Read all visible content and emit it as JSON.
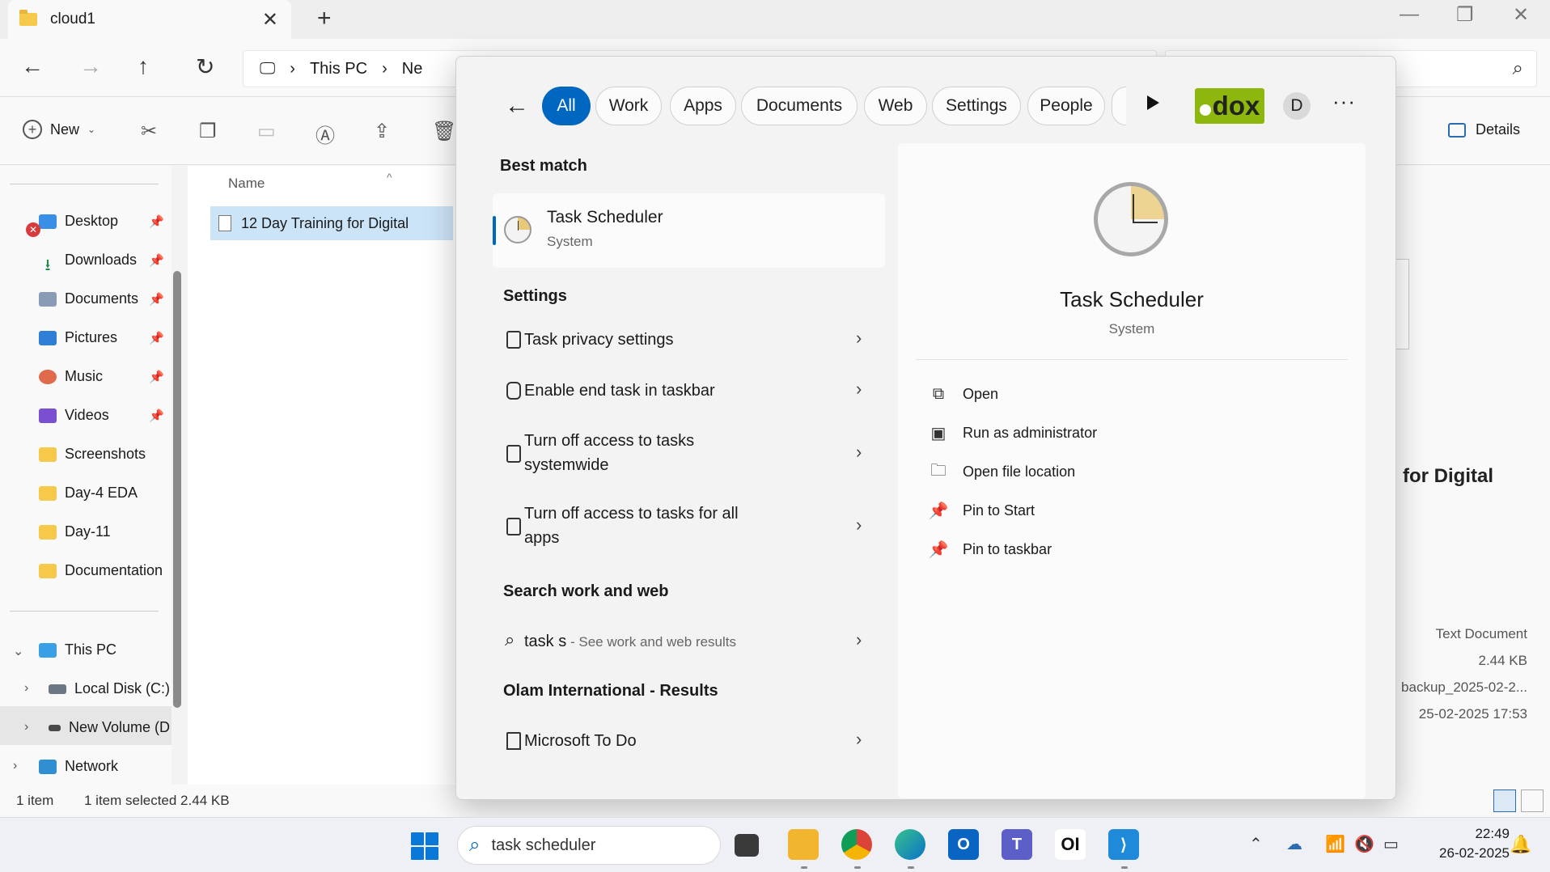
{
  "window": {
    "tab_title": "cloud1",
    "new_tab": "+",
    "minimize": "—",
    "restore": "❐",
    "close": "✕"
  },
  "nav": {
    "back": "←",
    "forward": "→",
    "up": "↑",
    "refresh": "↻",
    "breadcrumb": [
      "This PC",
      "Ne"
    ]
  },
  "commandbar": {
    "new_label": "New",
    "details_label": "Details"
  },
  "sidebar": {
    "quick_access": [
      {
        "label": "Desktop",
        "pinned": true
      },
      {
        "label": "Downloads",
        "pinned": true
      },
      {
        "label": "Documents",
        "pinned": true
      },
      {
        "label": "Pictures",
        "pinned": true
      },
      {
        "label": "Music",
        "pinned": true
      },
      {
        "label": "Videos",
        "pinned": true
      },
      {
        "label": "Screenshots",
        "pinned": false
      },
      {
        "label": "Day-4 EDA",
        "pinned": false
      },
      {
        "label": "Day-11",
        "pinned": false
      },
      {
        "label": "Documentation",
        "pinned": false
      }
    ],
    "this_pc": "This PC",
    "drives": [
      "Local Disk (C:)",
      "New Volume (D"
    ],
    "network": "Network"
  },
  "files": {
    "column_name": "Name",
    "rows": [
      "12 Day Training for Digital"
    ]
  },
  "preview": {
    "title": "g for Digital",
    "type": "Text Document",
    "size": "2.44 KB",
    "path": "backup_2025-02-2...",
    "modified": "25-02-2025 17:53"
  },
  "statusbar": {
    "count": "1 item",
    "selected": "1 item selected  2.44 KB"
  },
  "search": {
    "filters": [
      "All",
      "Work",
      "Apps",
      "Documents",
      "Web",
      "Settings",
      "People"
    ],
    "active_filter": "All",
    "org_logo": "dox",
    "avatar_letter": "D",
    "more": "···",
    "best_match_heading": "Best match",
    "best_match": {
      "name": "Task Scheduler",
      "type": "System"
    },
    "settings_heading": "Settings",
    "settings": [
      "Task privacy settings",
      "Enable end task in taskbar",
      "Turn off access to tasks systemwide",
      "Turn off access to tasks for all apps"
    ],
    "web_heading": "Search work and web",
    "web_query": "task s",
    "web_hint": " - See work and web results",
    "org_heading": "Olam International - Results",
    "org_results": [
      "Microsoft To Do"
    ],
    "detail": {
      "name": "Task Scheduler",
      "type": "System",
      "actions": [
        "Open",
        "Run as administrator",
        "Open file location",
        "Pin to Start",
        "Pin to taskbar"
      ]
    }
  },
  "taskbar": {
    "search_text": "task scheduler",
    "apps": [
      "File Explorer",
      "Chrome",
      "Edge",
      "Outlook",
      "Teams",
      "OI",
      "VS Code"
    ],
    "oi_label": "OI",
    "time": "22:49",
    "date": "26-02-2025"
  },
  "colors": {
    "accent": "#0067c0",
    "selection": "#cce4f7",
    "dox_green": "#8db70d"
  }
}
